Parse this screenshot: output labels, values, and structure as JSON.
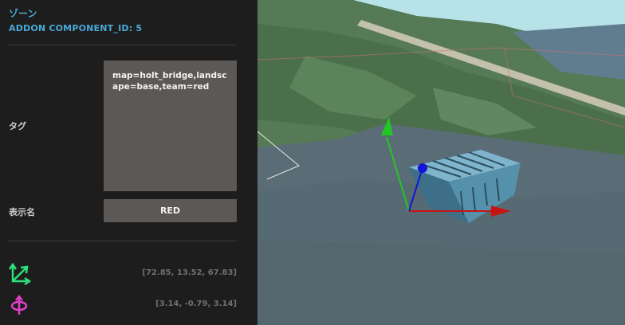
{
  "panel": {
    "title": "ゾーン",
    "subtitle": "ADDON COMPONENT_ID: 5",
    "tag_label": "タグ",
    "tag_value": "map=holt_bridge,landscape=base,team=red",
    "name_label": "表示名",
    "name_value": "RED",
    "position_icon": "move-axes-icon",
    "position_value": "[72.85, 13.52, 67.83]",
    "rotation_icon": "rotate-icon",
    "rotation_value": "[3.14, -0.79, 3.14]"
  },
  "colors": {
    "accent": "#4aa8d8",
    "panel_bg": "#1d1d1d",
    "field_bg": "#5b5856",
    "position_icon": "#2ee07a",
    "rotation_icon": "#e040c8",
    "axis_x": "#c81414",
    "axis_y": "#22c822",
    "axis_z": "#1414d8",
    "sky": "#b6e2e8"
  }
}
